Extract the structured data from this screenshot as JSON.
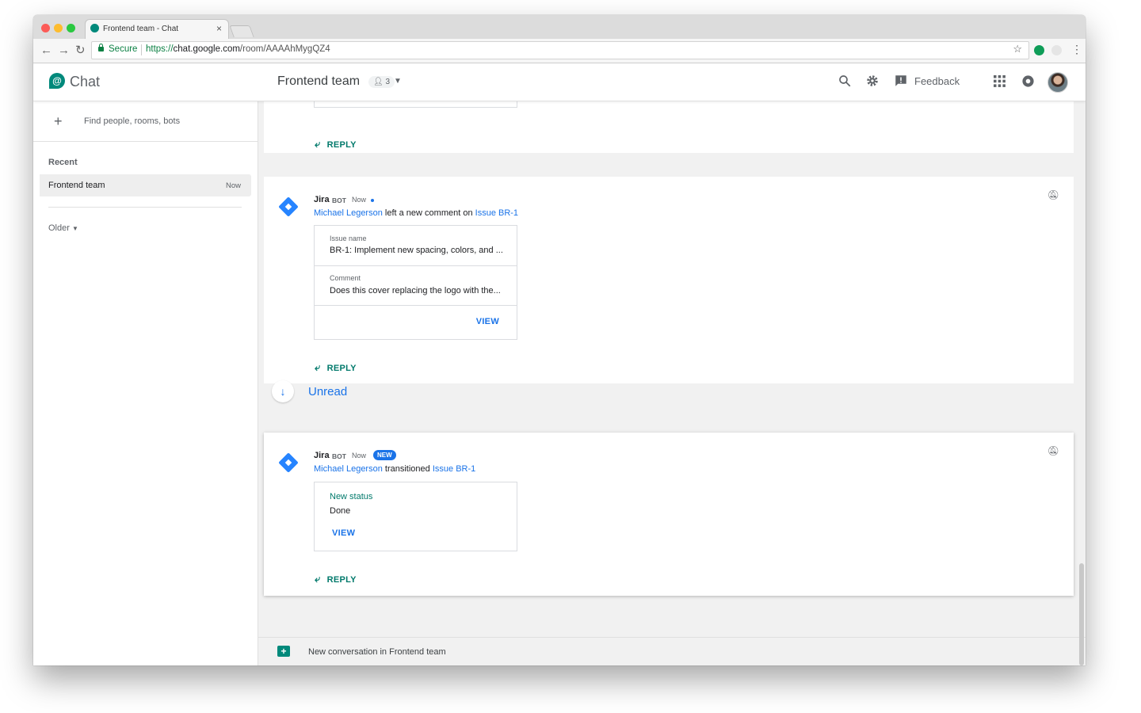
{
  "browser": {
    "tab_title": "Frontend team - Chat",
    "tab_close": "×",
    "secure_label": "Secure",
    "url_scheme": "https://",
    "url_host": "chat.google.com",
    "url_path": "/room/AAAAhMygQZ4",
    "nav": {
      "back": "←",
      "forward": "→",
      "reload": "↻",
      "star": "☆",
      "menu": "⋮"
    }
  },
  "header": {
    "app_name": "Chat",
    "room_title": "Frontend team",
    "member_count": "3",
    "member_icon": "person-icon",
    "feedback_label": "Feedback"
  },
  "sidebar": {
    "find_placeholder": "Find people, rooms, bots",
    "recent_label": "Recent",
    "rooms": [
      {
        "name": "Frontend team",
        "time": "Now"
      }
    ],
    "older_label": "Older"
  },
  "messages": [
    {
      "reply_label": "REPLY"
    },
    {
      "sender": "Jira",
      "tag": "BOT",
      "time": "Now",
      "actor": "Michael Legerson",
      "action": "left a new comment on",
      "target": "Issue BR-1",
      "fields": [
        {
          "label": "Issue name",
          "value": "BR-1: Implement new spacing, colors, and ..."
        },
        {
          "label": "Comment",
          "value": "Does this cover replacing the logo with the..."
        }
      ],
      "view_label": "VIEW",
      "reply_label": "REPLY"
    },
    {
      "sender": "Jira",
      "tag": "BOT",
      "time": "Now",
      "badge": "NEW",
      "actor": "Michael Legerson",
      "action": "transitioned",
      "target": "Issue BR-1",
      "status_label": "New status",
      "status_value": "Done",
      "view_label": "VIEW",
      "reply_label": "REPLY"
    }
  ],
  "unread_label": "Unread",
  "composer": {
    "label": "New conversation in Frontend team"
  },
  "colors": {
    "accent_teal": "#00796b",
    "link_blue": "#1a73e8",
    "jira_blue": "#2684ff"
  }
}
